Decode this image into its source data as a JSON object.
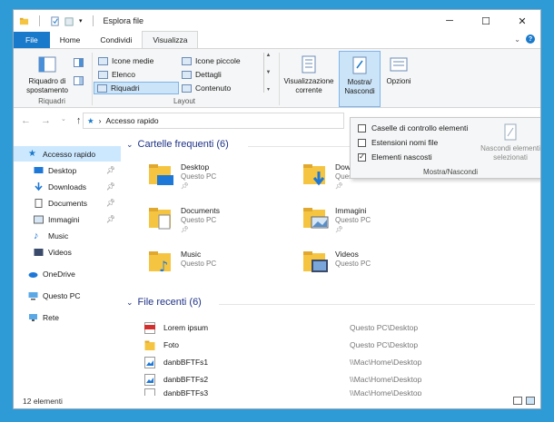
{
  "window": {
    "title": "Esplora file"
  },
  "tabs": {
    "file": "File",
    "home": "Home",
    "share": "Condividi",
    "view": "Visualizza"
  },
  "ribbon": {
    "pane": {
      "label": "Riquadro di spostamento"
    },
    "group_pane": "Riquadri",
    "layout_items": [
      "Icone medie",
      "Elenco",
      "Riquadri",
      "Icone piccole",
      "Dettagli",
      "Contenuto"
    ],
    "group_layout": "Layout",
    "current_view": "Visualizzazione corrente",
    "show_hide": "Mostra/ Nascondi",
    "options": "Opzioni"
  },
  "nav": {
    "address": "Accesso rapido"
  },
  "sidebar": {
    "items": [
      {
        "label": "Accesso rapido",
        "icon": "star-icon",
        "pinned": false
      },
      {
        "label": "Desktop",
        "icon": "desktop-icon",
        "pinned": true
      },
      {
        "label": "Downloads",
        "icon": "download-icon",
        "pinned": true
      },
      {
        "label": "Documents",
        "icon": "document-icon",
        "pinned": true
      },
      {
        "label": "Immagini",
        "icon": "image-icon",
        "pinned": true
      },
      {
        "label": "Music",
        "icon": "music-icon",
        "pinned": false
      },
      {
        "label": "Videos",
        "icon": "video-icon",
        "pinned": false
      },
      {
        "label": "OneDrive",
        "icon": "cloud-icon",
        "pinned": false
      },
      {
        "label": "Questo PC",
        "icon": "pc-icon",
        "pinned": false
      },
      {
        "label": "Rete",
        "icon": "network-icon",
        "pinned": false
      }
    ]
  },
  "frequent": {
    "title": "Cartelle frequenti (6)",
    "folders": [
      {
        "name": "Desktop",
        "location": "Questo PC",
        "pinned": true
      },
      {
        "name": "Downloads",
        "location": "Questo PC",
        "pinned": true
      },
      {
        "name": "Documents",
        "location": "Questo PC",
        "pinned": true
      },
      {
        "name": "Immagini",
        "location": "Questo PC",
        "pinned": true
      },
      {
        "name": "Music",
        "location": "Questo PC",
        "pinned": false
      },
      {
        "name": "Videos",
        "location": "Questo PC",
        "pinned": false
      }
    ]
  },
  "recent": {
    "title": "File recenti (6)",
    "files": [
      {
        "name": "Lorem ipsum",
        "path": "Questo PC\\Desktop",
        "icon": "pdf-icon"
      },
      {
        "name": "Foto",
        "path": "Questo PC\\Desktop",
        "icon": "folder-icon"
      },
      {
        "name": "danbBFTFs1",
        "path": "\\\\Mac\\Home\\Desktop",
        "icon": "image-file-icon"
      },
      {
        "name": "danbBFTFs2",
        "path": "\\\\Mac\\Home\\Desktop",
        "icon": "image-file-icon"
      },
      {
        "name": "danbBFTFs3",
        "path": "\\\\Mac\\Home\\Desktop",
        "icon": "image-file-icon"
      }
    ]
  },
  "dropdown": {
    "items": [
      {
        "label": "Caselle di controllo elementi",
        "checked": false
      },
      {
        "label": "Estensioni nomi file",
        "checked": false
      },
      {
        "label": "Elementi nascosti",
        "checked": true
      }
    ],
    "hide_selected": "Nascondi elementi selezionati",
    "group": "Mostra/Nascondi"
  },
  "status": {
    "count": "12 elementi"
  },
  "colors": {
    "accent": "#1979ca",
    "folder": "#f5c542",
    "background": "#2e9bd6"
  }
}
